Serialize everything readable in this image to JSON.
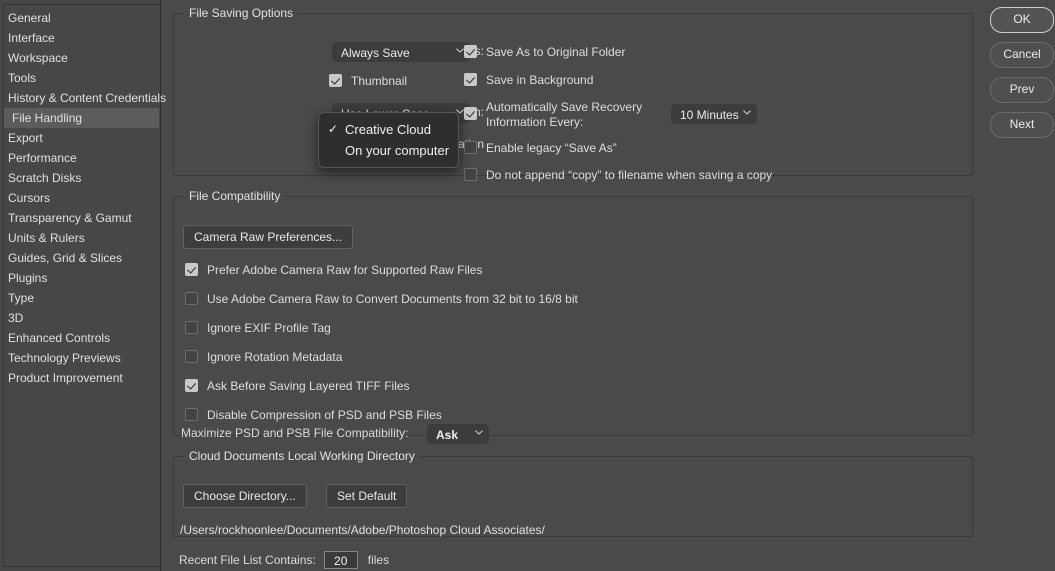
{
  "sidebar": {
    "items": [
      {
        "label": "General",
        "selected": false
      },
      {
        "label": "Interface",
        "selected": false
      },
      {
        "label": "Workspace",
        "selected": false
      },
      {
        "label": "Tools",
        "selected": false
      },
      {
        "label": "History & Content Credentials",
        "selected": false
      },
      {
        "label": "File Handling",
        "selected": true
      },
      {
        "label": "Export",
        "selected": false
      },
      {
        "label": "Performance",
        "selected": false
      },
      {
        "label": "Scratch Disks",
        "selected": false
      },
      {
        "label": "Cursors",
        "selected": false
      },
      {
        "label": "Transparency & Gamut",
        "selected": false
      },
      {
        "label": "Units & Rulers",
        "selected": false
      },
      {
        "label": "Guides, Grid & Slices",
        "selected": false
      },
      {
        "label": "Plugins",
        "selected": false
      },
      {
        "label": "Type",
        "selected": false
      },
      {
        "label": "3D",
        "selected": false
      },
      {
        "label": "Enhanced Controls",
        "selected": false
      },
      {
        "label": "Technology Previews",
        "selected": false
      },
      {
        "label": "Product Improvement",
        "selected": false
      }
    ]
  },
  "buttons": {
    "ok": "OK",
    "cancel": "Cancel",
    "prev": "Prev",
    "next": "Next"
  },
  "file_saving": {
    "legend": "File Saving Options",
    "image_previews_label": "Image Previews:",
    "image_previews_value": "Always Save",
    "thumbnail_label": "Thumbnail",
    "thumbnail_checked": true,
    "file_extension_label": "File Extension:",
    "file_extension_value": "Use Lower Case",
    "default_file_location_label": "Default File Location",
    "save_as_original_folder": "Save As to Original Folder",
    "save_as_original_folder_checked": true,
    "save_in_background": "Save in Background",
    "save_in_background_checked": true,
    "auto_save_recovery_line1": "Automatically Save Recovery",
    "auto_save_recovery_line2": "Information Every:",
    "auto_save_recovery_checked": true,
    "auto_save_interval_value": "10 Minutes",
    "enable_legacy_save_as": "Enable legacy “Save As”",
    "enable_legacy_save_as_checked": false,
    "do_not_append_copy": "Do not append “copy” to filename when saving a copy",
    "do_not_append_copy_checked": false
  },
  "location_menu": {
    "items": [
      {
        "label": "Creative Cloud",
        "checked": true,
        "tick": "✓"
      },
      {
        "label": "On your computer",
        "checked": false,
        "tick": ""
      }
    ]
  },
  "file_compatibility": {
    "legend": "File Compatibility",
    "camera_raw_button": "Camera Raw Preferences...",
    "checkboxes": [
      {
        "label": "Prefer Adobe Camera Raw for Supported Raw Files",
        "checked": true
      },
      {
        "label": "Use Adobe Camera Raw to Convert Documents from 32 bit to 16/8 bit",
        "checked": false
      },
      {
        "label": "Ignore EXIF Profile Tag",
        "checked": false
      },
      {
        "label": "Ignore Rotation Metadata",
        "checked": false
      },
      {
        "label": "Ask Before Saving Layered TIFF Files",
        "checked": true
      },
      {
        "label": "Disable Compression of PSD and PSB Files",
        "checked": false
      }
    ],
    "maximize_label": "Maximize PSD and PSB File Compatibility:",
    "maximize_value": "Ask"
  },
  "cloud_documents": {
    "legend": "Cloud Documents Local Working Directory",
    "choose_directory_button": "Choose Directory...",
    "set_default_button": "Set Default",
    "path": "/Users/rockhoonlee/Documents/Adobe/Photoshop Cloud Associates/"
  },
  "recent_files": {
    "label": "Recent File List Contains:",
    "value": "20",
    "suffix": "files"
  },
  "colors": {
    "window_bg": "#4a4a4a",
    "sidebar_bg": "#474747",
    "selected_row": "#5c5c5c",
    "field_bg": "#3c3c3c",
    "popup_bg": "#2e2e2e",
    "text": "#dedede",
    "checkbox_on": "#c9c9c9"
  }
}
